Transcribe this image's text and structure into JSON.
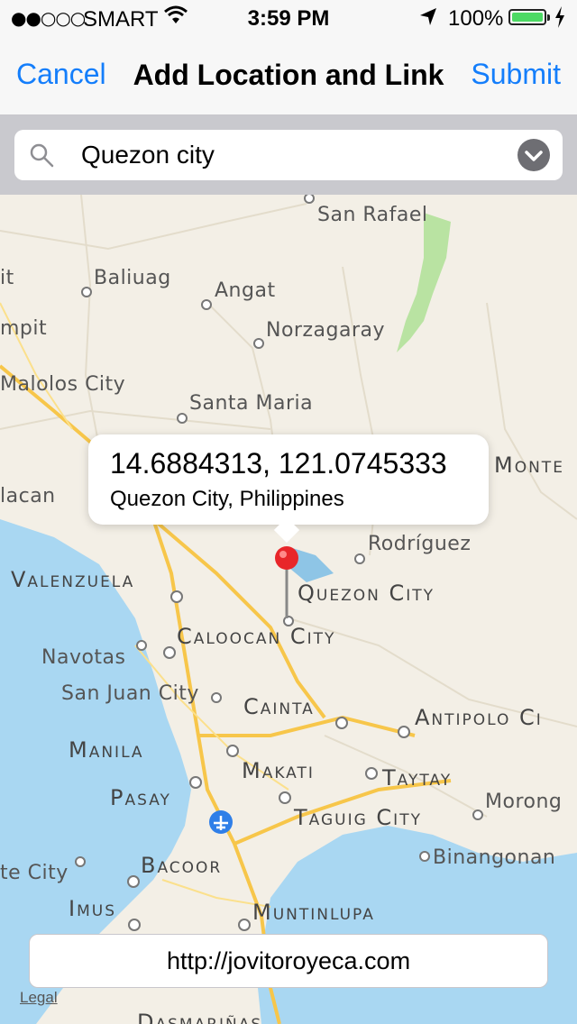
{
  "status": {
    "signal": "●●○○○",
    "carrier": "SMART",
    "time": "3:59 PM",
    "battery": "100%"
  },
  "nav": {
    "cancel": "Cancel",
    "title": "Add Location and Link",
    "submit": "Submit"
  },
  "search": {
    "value": "Quezon city"
  },
  "callout": {
    "coords": "14.6884313, 121.0745333",
    "address": "Quezon City, Philippines"
  },
  "map": {
    "labels": {
      "san_rafael": "San Rafael",
      "baliuag": "Baliuag",
      "angat": "Angat",
      "pit": "it",
      "pampanga": "mpit",
      "norzagaray": "Norzagaray",
      "malolos": "Malolos City",
      "santa_maria": "Santa Maria",
      "bulacan": "lacan",
      "monte": "Monte",
      "rodriguez": "Rodríguez",
      "valenzuela": "Valenzuela",
      "quezon_city": "Quezon City",
      "caloocan": "Caloocan City",
      "navotas": "Navotas",
      "san_juan": "San Juan City",
      "cainta": "Cainta",
      "antipolo": "Antipolo Ci",
      "manila": "Manila",
      "makati": "Makati",
      "taytay": "Taytay",
      "pasay": "Pasay",
      "morong": "Morong",
      "taguig": "Taguig City",
      "binangonan": "Binangonan",
      "cavite_city": "te City",
      "bacoor": "Bacoor",
      "imus": "Imus",
      "muntinlupa": "Muntinlupa",
      "dasmarinas": "Dasmariñas"
    }
  },
  "link": {
    "url": "http://jovitoroyeca.com"
  },
  "legal": "Legal",
  "colors": {
    "accent": "#147efb",
    "water": "#a9d7f2",
    "road": "#f7c64a",
    "park": "#b9e3a2",
    "pin": "#e8262a"
  },
  "icons": {
    "search": "magnifier-icon",
    "dropdown": "chevron-down-icon",
    "pin": "map-pin-icon",
    "airport": "airplane-icon"
  }
}
